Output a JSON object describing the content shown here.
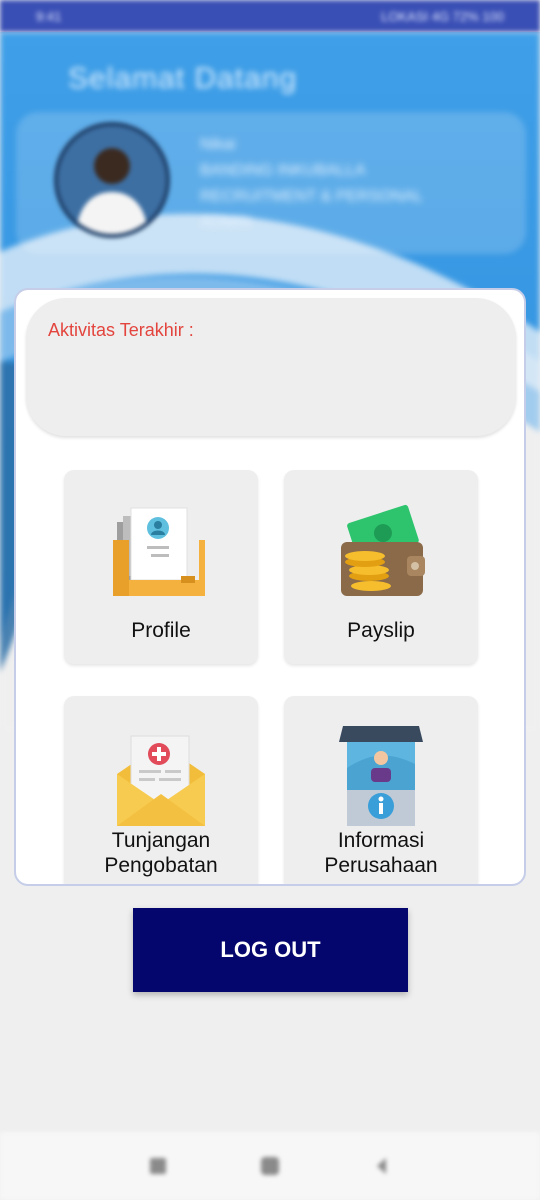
{
  "status_bar": {
    "time": "9:41",
    "right": "LOKASI 4G 72% 100"
  },
  "header": {
    "greeting": "Selamat Datang"
  },
  "user": {
    "line1": "Nikai",
    "line2": "BANDING INKUBALLA",
    "line3": "RECRUITMENT & PERSONAL",
    "line4": "ADMIN"
  },
  "activity": {
    "label": "Aktivitas Terakhir :"
  },
  "menu": [
    {
      "label": "Profile",
      "icon": "profile-folder-icon"
    },
    {
      "label": "Payslip",
      "icon": "wallet-icon"
    },
    {
      "label_line1": "Tunjangan",
      "label_line2": "Pengobatan",
      "icon": "medical-envelope-icon"
    },
    {
      "label_line1": "Informasi",
      "label_line2": "Perusahaan",
      "icon": "company-info-icon"
    }
  ],
  "logout": {
    "label": "LOG OUT"
  },
  "colors": {
    "accent": "#05056e",
    "activity_label": "#e3453e",
    "status_bar": "#3a4fb5",
    "hero": "#3d9ce6"
  }
}
